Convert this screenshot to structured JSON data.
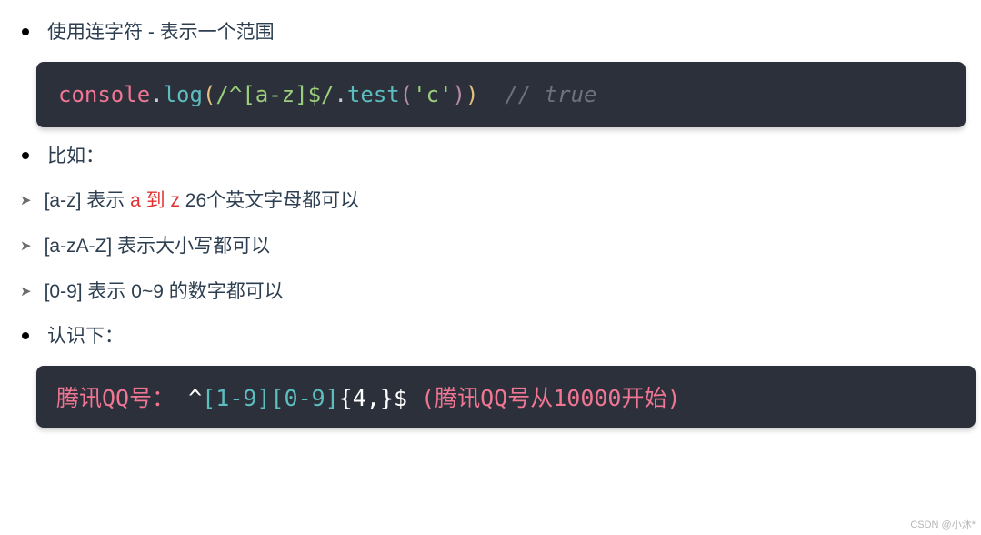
{
  "lines": {
    "l1": "使用连字符 - 表示一个范围",
    "l2": "比如：",
    "l3a": "[a-z]  表示 ",
    "l3b": "a 到 z",
    "l3c": " 26个英文字母都可以",
    "l4": "[a-zA-Z]   表示大小写都可以",
    "l5": "[0-9]  表示 0~9 的数字都可以",
    "l6": " 认识下："
  },
  "code1": {
    "c1": "console",
    "c2": ".",
    "c3": "log",
    "c4": "(",
    "c5": "/^[a-z]$/",
    "c6": ".",
    "c7": "test",
    "c8": "(",
    "c9": "'c'",
    "c10": ")",
    "c11": ")",
    "c12": "  ",
    "c13": "// true"
  },
  "code2": {
    "c1": "腾讯QQ号： ",
    "c2": "^",
    "c3": "[1-9][0-9]",
    "c4": "{4,}",
    "c5": "$",
    "c6": " (腾讯QQ号从10000开始)"
  },
  "watermark": "CSDN @小沐*"
}
